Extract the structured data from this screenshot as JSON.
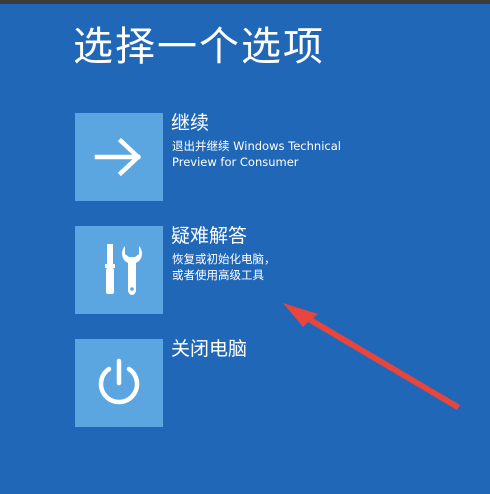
{
  "title": "选择一个选项",
  "options": [
    {
      "title": "继续",
      "description": "退出并继续 Windows Technical\nPreview for Consumer",
      "icon": "arrow-right-icon"
    },
    {
      "title": "疑难解答",
      "description": "恢复或初始化电脑，\n或者使用高级工具",
      "icon": "tools-icon"
    },
    {
      "title": "关闭电脑",
      "description": "",
      "icon": "power-icon"
    }
  ],
  "colors": {
    "background": "#2067b7",
    "tile": "#5ba5e0",
    "annotation_arrow": "#e8453c"
  }
}
